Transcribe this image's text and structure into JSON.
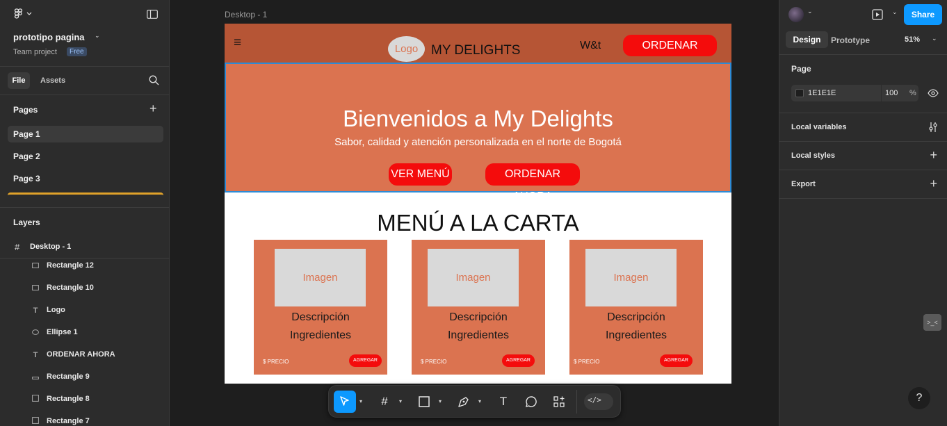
{
  "left_panel": {
    "project_name": "prototipo pagina",
    "team": "Team project",
    "plan_badge": "Free",
    "tabs": {
      "file": "File",
      "assets": "Assets"
    },
    "pages_heading": "Pages",
    "pages": [
      "Page 1",
      "Page 2",
      "Page 3"
    ],
    "layers_heading": "Layers",
    "frame_name": "Desktop - 1",
    "layers": [
      {
        "name": "Rectangle 12",
        "icon": "rectangle-icon"
      },
      {
        "name": "Rectangle 10",
        "icon": "rectangle-icon"
      },
      {
        "name": "Logo",
        "icon": "text-icon"
      },
      {
        "name": "Ellipse 1",
        "icon": "ellipse-icon"
      },
      {
        "name": "ORDENAR AHORA",
        "icon": "text-icon"
      },
      {
        "name": "Rectangle 9",
        "icon": "rectangle-icon"
      },
      {
        "name": "Rectangle 8",
        "icon": "rectangle-icon"
      },
      {
        "name": "Rectangle 7",
        "icon": "rectangle-icon"
      }
    ]
  },
  "canvas": {
    "frame_label": "Desktop - 1",
    "nav": {
      "logo": "Logo",
      "brand": "MY DELIGHTS",
      "link": "W&t",
      "cta": "ORDENAR AHORA"
    },
    "hero": {
      "title": "Bienvenidos a My Delights",
      "subtitle": "Sabor, calidad y atención personalizada en el norte de Bogotá",
      "btn_menu": "VER MENÚ",
      "btn_order": "ORDENAR AHORA"
    },
    "menu_heading": "MENÚ A LA CARTA",
    "cards": [
      {
        "image": "Imagen",
        "desc": "Descripción",
        "ingredients": "Ingredientes",
        "price": "$ PRECIO",
        "add": "AGREGAR"
      },
      {
        "image": "Imagen",
        "desc": "Descripción",
        "ingredients": "Ingredientes",
        "price": "$ PRECIO",
        "add": "AGREGAR"
      },
      {
        "image": "Imagen",
        "desc": "Descripción",
        "ingredients": "Ingredientes",
        "price": "$ PRECIO",
        "add": "AGREGAR"
      }
    ]
  },
  "right_panel": {
    "share": "Share",
    "tabs": {
      "design": "Design",
      "prototype": "Prototype"
    },
    "zoom": "51%",
    "page_heading": "Page",
    "page_color": "1E1E1E",
    "page_opacity": "100",
    "percent": "%",
    "local_variables": "Local variables",
    "local_styles": "Local styles",
    "export": "Export"
  },
  "help": "?",
  "colors": {
    "accent": "#0d99ff",
    "nav_bg": "#b65535",
    "hero_bg": "#db7350",
    "cta_red": "#f40c0c",
    "selection": "#2d8bd6"
  }
}
